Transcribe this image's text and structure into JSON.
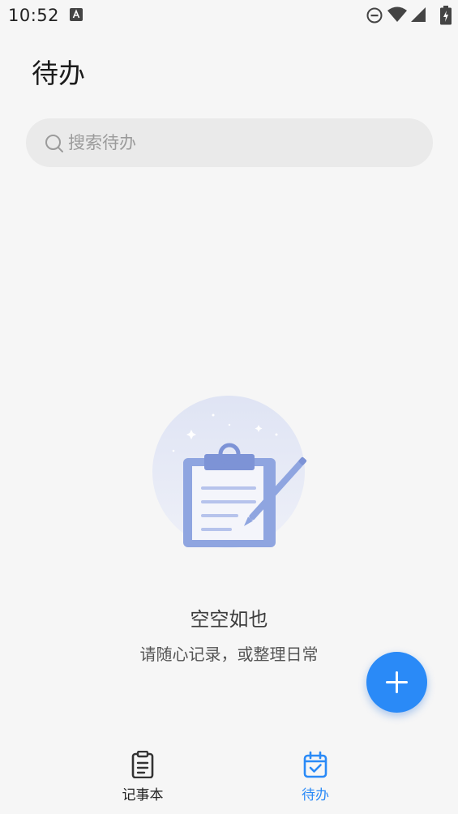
{
  "status_bar": {
    "time": "10:52"
  },
  "header": {
    "title": "待办"
  },
  "search": {
    "placeholder": "搜索待办",
    "value": ""
  },
  "empty_state": {
    "title": "空空如也",
    "subtitle": "请随心记录，或整理日常"
  },
  "fab": {
    "icon": "plus-icon"
  },
  "bottom_nav": {
    "items": [
      {
        "label": "记事本",
        "icon": "notepad-icon",
        "active": false
      },
      {
        "label": "待办",
        "icon": "todo-calendar-icon",
        "active": true
      }
    ]
  },
  "colors": {
    "accent": "#2a8af7",
    "background": "#f6f6f6",
    "search_bg": "#eaeaea",
    "illustration_bg": "#d9dff0",
    "illustration_accent": "#8fa5e0"
  }
}
